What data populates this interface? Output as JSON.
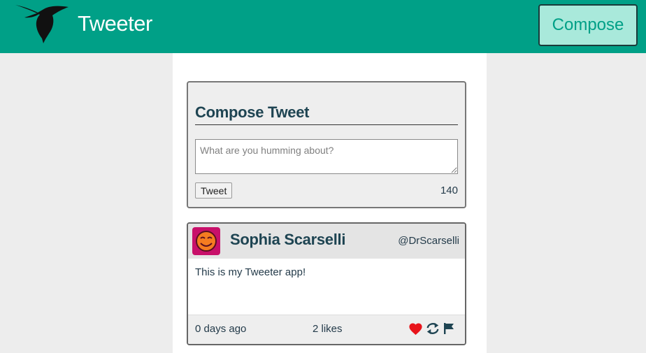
{
  "nav": {
    "title": "Tweeter",
    "compose_label": "Compose",
    "logo_icon": "hummingbird-icon"
  },
  "compose": {
    "heading": "Compose Tweet",
    "placeholder": "What are you humming about?",
    "value": "",
    "submit_label": "Tweet",
    "counter": "140"
  },
  "tweets": [
    {
      "name": "Sophia Scarselli",
      "handle": "@DrScarselli",
      "content": "This is my Tweeter app!",
      "time_ago": "0 days ago",
      "likes": "2 likes",
      "avatar_icon": "smiley-face-icon",
      "actions": [
        "heart-icon",
        "retweet-icon",
        "flag-icon"
      ]
    }
  ],
  "colors": {
    "brand": "#00a087",
    "compose_button_bg": "#a9e9db",
    "heading": "#1e4452",
    "heart": "#e8141b",
    "avatar_bg": "#c8106a"
  }
}
